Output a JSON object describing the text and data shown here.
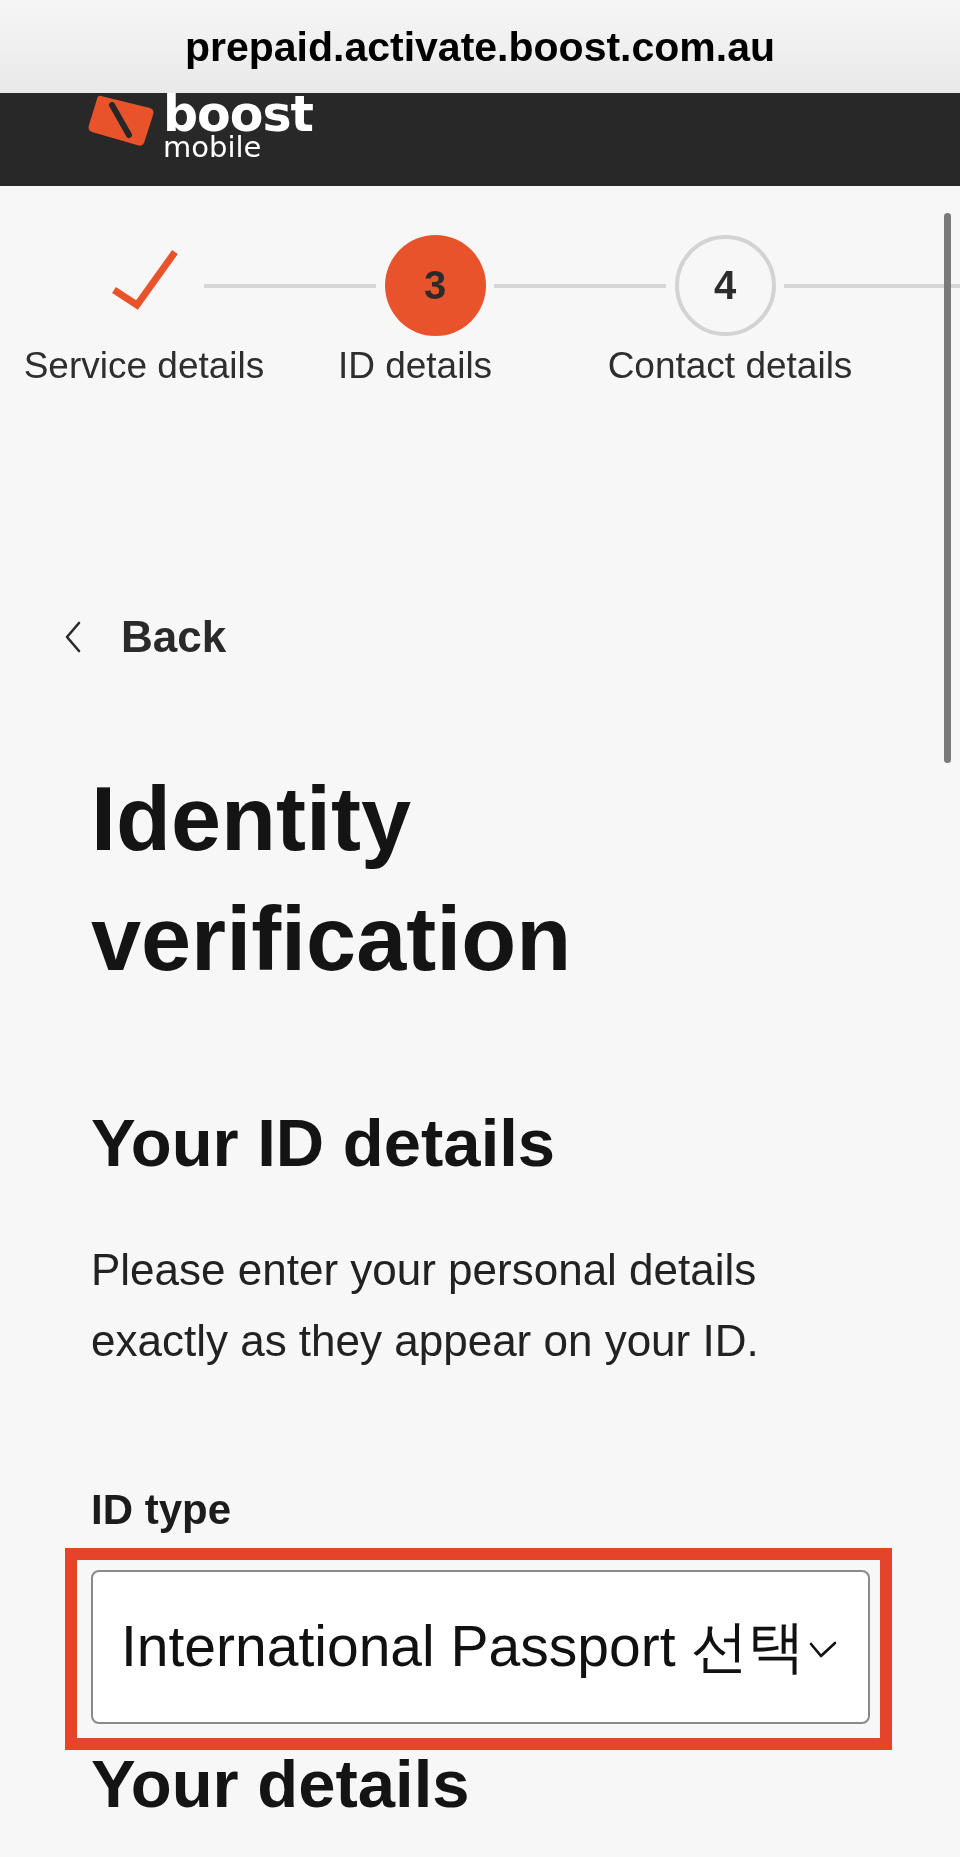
{
  "browser": {
    "url": "prepaid.activate.boost.com.au"
  },
  "header": {
    "logo": {
      "wordmark": "boost",
      "tagline": "mobile"
    }
  },
  "stepper": {
    "steps": [
      {
        "kind": "done",
        "label": "Service details"
      },
      {
        "kind": "current",
        "number": "3",
        "label": "ID details"
      },
      {
        "kind": "upcoming",
        "number": "4",
        "label": "Contact details"
      }
    ]
  },
  "back_link": {
    "label": "Back"
  },
  "page_title": "Identity verification",
  "section": {
    "heading": "Your ID details",
    "intro": "Please enter your personal details exactly as they appear on your ID.",
    "id_type": {
      "label": "ID type",
      "value": "International Passport 선택",
      "highlighted": true
    }
  },
  "next_section": {
    "heading": "Your details"
  }
}
